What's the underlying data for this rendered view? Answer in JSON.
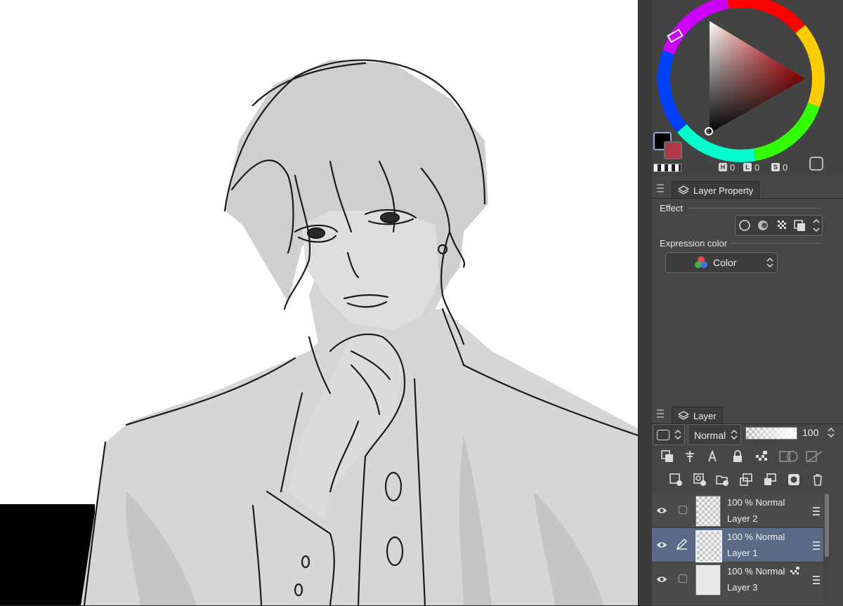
{
  "color_panel": {
    "hsv": [
      {
        "key": "H",
        "value": "0"
      },
      {
        "key": "L",
        "value": "0"
      },
      {
        "key": "S",
        "value": "0"
      }
    ],
    "main_color": "#000000",
    "sub_color": "#b13848"
  },
  "layer_property": {
    "tab_label": "Layer Property",
    "effect_label": "Effect",
    "expression_color_label": "Expression color",
    "expression_color_value": "Color"
  },
  "layer_panel": {
    "tab_label": "Layer",
    "blend_mode": "Normal",
    "opacity": "100",
    "layers": [
      {
        "mode": "100 %  Normal",
        "name": "Layer 2",
        "selected": false
      },
      {
        "mode": "100 %  Normal",
        "name": "Layer 1",
        "selected": true
      },
      {
        "mode": "100 %  Normal",
        "name": "Layer 3",
        "selected": false
      }
    ]
  }
}
